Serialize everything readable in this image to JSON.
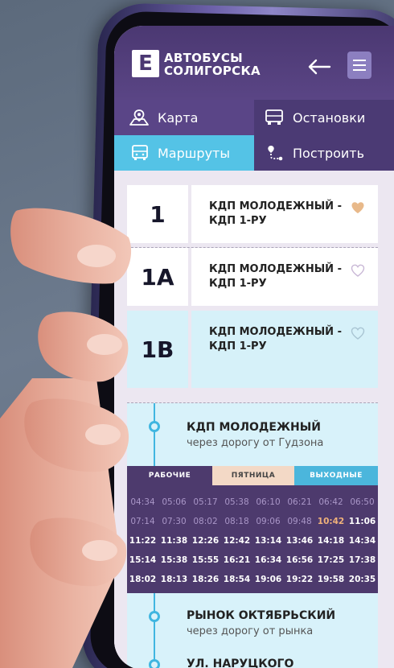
{
  "app": {
    "title_line1": "АВТОБУСЫ",
    "title_line2": "СОЛИГОРСКА",
    "logo_glyph": "Е"
  },
  "nav": {
    "map": "Карта",
    "stops": "Остановки",
    "routes": "Маршруты",
    "build": "Построить"
  },
  "routes": [
    {
      "number": "1",
      "name_line1": "КДП МОЛОДЕЖНЫЙ -",
      "name_line2": "КДП 1-РУ",
      "favorite": true
    },
    {
      "number": "1А",
      "name_line1": "КДП МОЛОДЕЖНЫЙ -",
      "name_line2": "КДП 1-РУ",
      "favorite": false
    },
    {
      "number": "1В",
      "name_line1": "КДП МОЛОДЕЖНЫЙ -",
      "name_line2": "КДП 1-РУ",
      "favorite": false
    }
  ],
  "stops": [
    {
      "name": "КДП МОЛОДЕЖНЫЙ",
      "sub": "через дорогу от Гудзона"
    },
    {
      "name": "РЫНОК ОКТЯБРЬСКИЙ",
      "sub": "через дорогу от рынка"
    },
    {
      "name": "УЛ. НАРУЦКОГО",
      "sub": ""
    }
  ],
  "schedule_tabs": {
    "weekday": "РАБОЧИЕ",
    "friday": "ПЯТНИЦА",
    "weekend": "ВЫХОДНЫЕ"
  },
  "timetable": [
    [
      "04:34",
      "05:06",
      "05:17",
      "05:38",
      "06:10",
      "06:21",
      "06:42",
      "06:50"
    ],
    [
      "07:14",
      "07:30",
      "08:02",
      "08:18",
      "09:06",
      "09:48",
      "10:42",
      "11:06"
    ],
    [
      "11:22",
      "11:38",
      "12:26",
      "12:42",
      "13:14",
      "13:46",
      "14:18",
      "14:34"
    ],
    [
      "15:14",
      "15:38",
      "15:55",
      "16:21",
      "16:34",
      "16:56",
      "17:25",
      "17:38"
    ],
    [
      "18:02",
      "18:13",
      "18:26",
      "18:54",
      "19:06",
      "19:22",
      "19:58",
      "20:35"
    ]
  ],
  "timetable_next": "10:42",
  "colors": {
    "header": "#4b3872",
    "accent_blue": "#54c3e6",
    "timetable_bg": "#4d3a6d",
    "favorite_heart": "#e8b98a"
  },
  "icons": {
    "back": "arrow-left-icon",
    "menu": "hamburger-icon",
    "map": "map-pin-icon",
    "stops": "bus-icon",
    "routes": "bus-front-icon",
    "build": "route-build-icon",
    "favorite": "heart-icon"
  }
}
